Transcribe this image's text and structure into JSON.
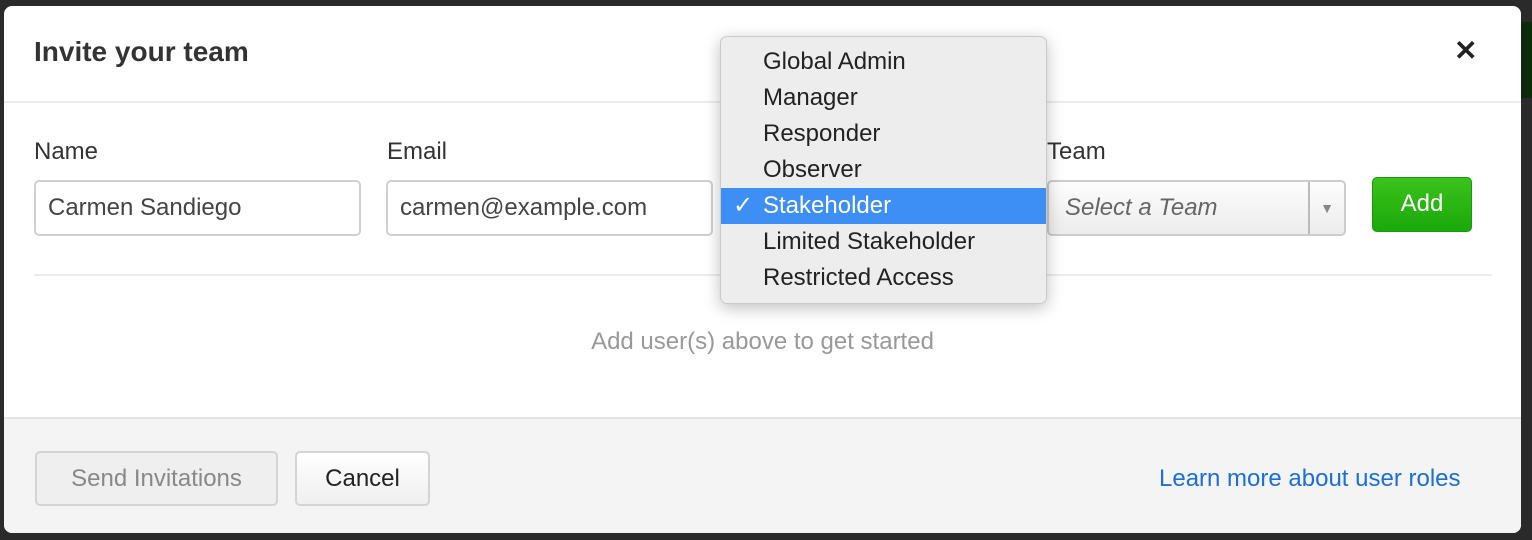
{
  "modal": {
    "title": "Invite your team",
    "close_icon": "close-icon"
  },
  "form": {
    "name_label": "Name",
    "name_value": "Carmen Sandiego",
    "email_label": "Email",
    "email_value": "carmen@example.com",
    "team_label": "Team",
    "team_placeholder": "Select a Team",
    "add_label": "Add"
  },
  "role_dropdown": {
    "options": [
      "Global Admin",
      "Manager",
      "Responder",
      "Observer",
      "Stakeholder",
      "Limited Stakeholder",
      "Restricted Access"
    ],
    "selected": "Stakeholder",
    "check": "✓"
  },
  "empty_state": "Add user(s) above to get started",
  "footer": {
    "send_label": "Send Invitations",
    "cancel_label": "Cancel",
    "learn_more": "Learn more about user roles"
  },
  "colors": {
    "accent": "#3d8ff5",
    "add_button": "#1aa90a",
    "link": "#1a6fd8"
  }
}
